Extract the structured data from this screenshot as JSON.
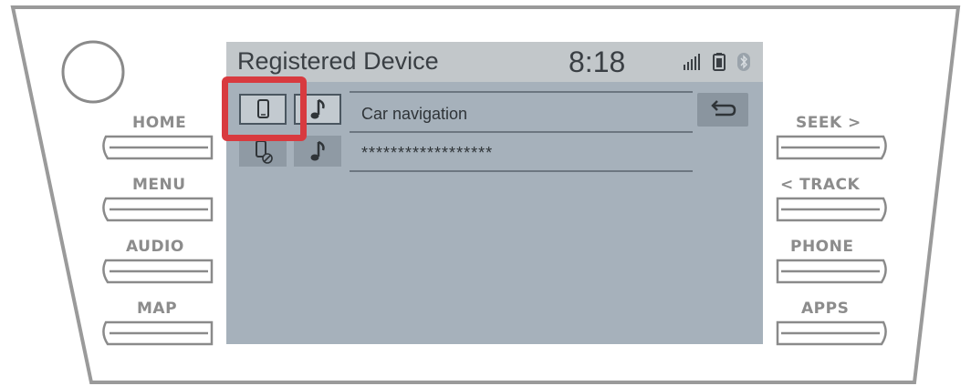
{
  "hardware_buttons": {
    "left": [
      "HOME",
      "MENU",
      "AUDIO",
      "MAP"
    ],
    "right": [
      "SEEK >",
      "< TRACK",
      "PHONE",
      "APPS"
    ]
  },
  "screen": {
    "title": "Registered Device",
    "clock": "8:18",
    "status_icons": [
      "signal-icon",
      "battery-icon",
      "bluetooth-icon"
    ],
    "devices": [
      {
        "name": "Car navigation",
        "icons": [
          "phone-icon",
          "music-note-icon"
        ],
        "phone_selected": true
      },
      {
        "name": "******************",
        "icons": [
          "phone-off-icon",
          "music-note-icon"
        ],
        "phone_selected": false
      }
    ],
    "back_icon": "back-arrow-icon"
  },
  "colors": {
    "screen_bg": "#a6b1bb",
    "highlight": "#d83a3f",
    "hardware_label": "#8c8c8c"
  }
}
